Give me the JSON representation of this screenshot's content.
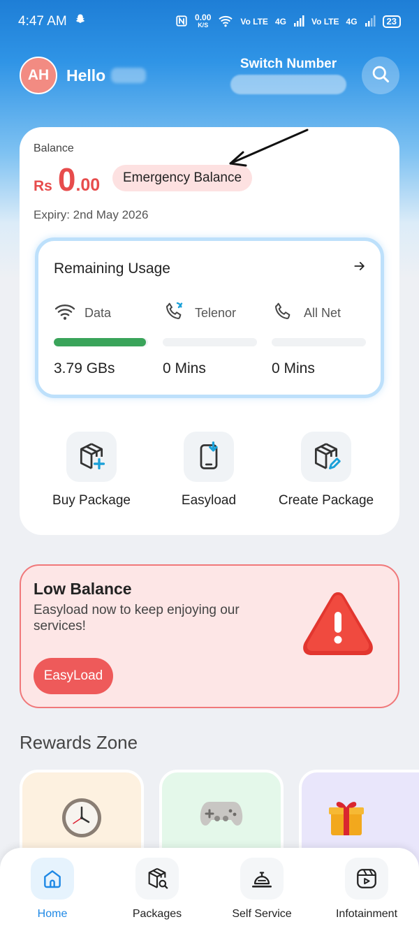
{
  "status_bar": {
    "time": "4:47 AM",
    "speed_value": "0.00",
    "speed_unit": "K/S",
    "net1": "Vo LTE",
    "net1_gen": "4G",
    "net2": "Vo LTE",
    "net2_gen": "4G",
    "battery": "23"
  },
  "header": {
    "avatar_initials": "AH",
    "greeting": "Hello",
    "switch_label": "Switch Number"
  },
  "balance": {
    "label": "Balance",
    "currency": "Rs",
    "integer": "0",
    "decimal": ".00",
    "emergency_label": "Emergency Balance",
    "expiry": "Expiry: 2nd May 2026"
  },
  "usage": {
    "title": "Remaining Usage",
    "items": [
      {
        "label": "Data",
        "value": "3.79 GBs",
        "fill": 0.98
      },
      {
        "label": "Telenor",
        "value": "0 Mins",
        "fill": 0
      },
      {
        "label": "All Net",
        "value": "0 Mins",
        "fill": 0
      }
    ]
  },
  "actions": [
    {
      "label": "Buy Package"
    },
    {
      "label": "Easyload"
    },
    {
      "label": "Create Package"
    }
  ],
  "low_balance": {
    "title": "Low Balance",
    "message": "Easyload now to keep enjoying our services!",
    "button": "EasyLoad"
  },
  "rewards": {
    "title": "Rewards Zone",
    "cards": [
      {
        "icon": "clock-icon",
        "color": "#fdf1e0"
      },
      {
        "icon": "gamepad-icon",
        "color": "#e4f8ea"
      },
      {
        "icon": "gift-icon",
        "color": "#e9e6fb"
      }
    ]
  },
  "nav": [
    {
      "label": "Home",
      "icon": "home-icon",
      "active": true
    },
    {
      "label": "Packages",
      "icon": "packages-icon",
      "active": false
    },
    {
      "label": "Self Service",
      "icon": "self-service-icon",
      "active": false
    },
    {
      "label": "Infotainment",
      "icon": "infotainment-icon",
      "active": false
    }
  ]
}
